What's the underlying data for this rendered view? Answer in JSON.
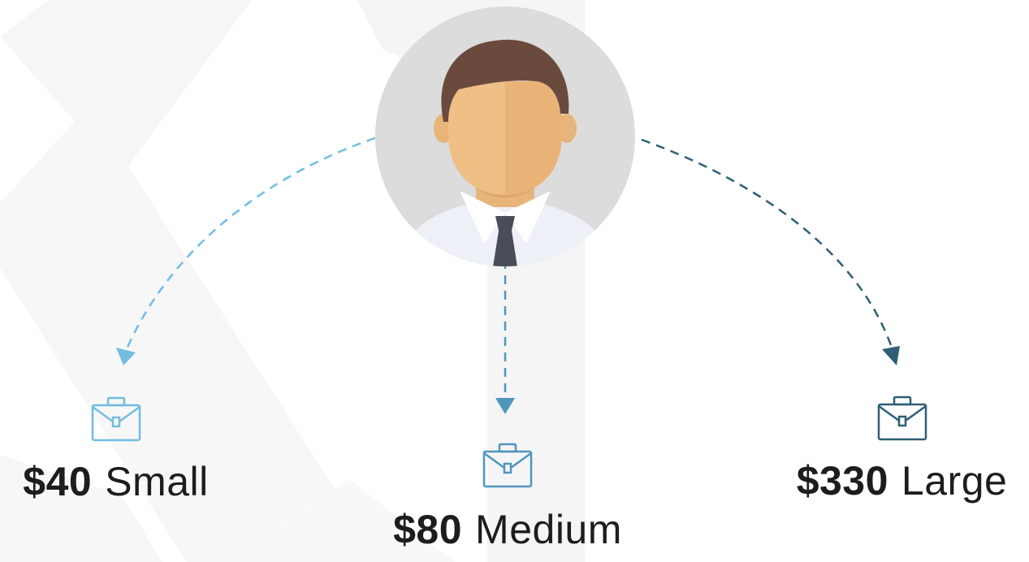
{
  "options": [
    {
      "price": "$40",
      "size": "Small",
      "color": "#72bde0"
    },
    {
      "price": "$80",
      "size": "Medium",
      "color": "#4f96bd"
    },
    {
      "price": "$330",
      "size": "Large",
      "color": "#2f5f75"
    }
  ],
  "avatar": {
    "circle_color": "#dcdcdc",
    "hair_color": "#6b4a3e",
    "skin_color": "#efbf85",
    "shirt_color": "#eef0f7",
    "tie_color": "#4a4c5a"
  },
  "icons": [
    "person-avatar",
    "briefcase-icon",
    "arrow-down-icon"
  ]
}
